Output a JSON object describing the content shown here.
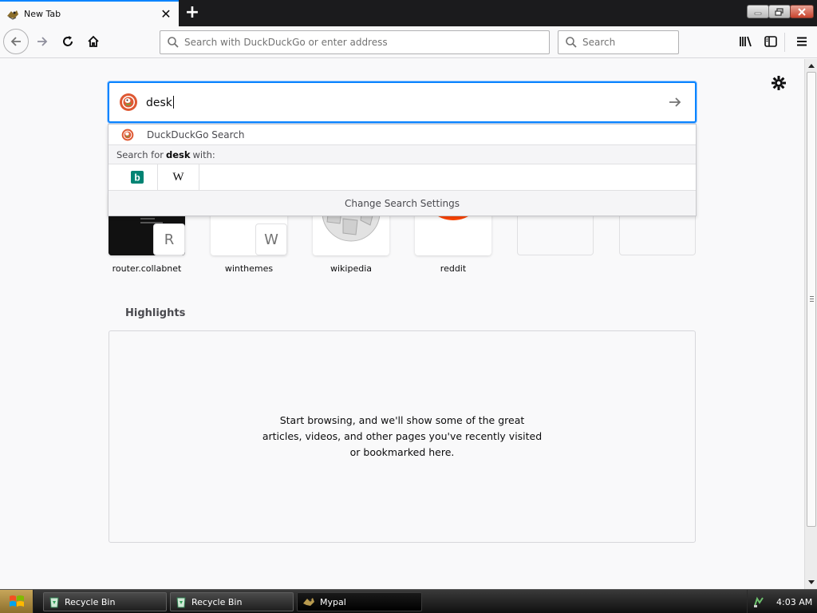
{
  "tab": {
    "title": "New Tab",
    "close_glyph": "✕",
    "new_tab_glyph": "+"
  },
  "toolbar": {
    "url_placeholder": "Search with DuckDuckGo or enter address",
    "search_placeholder": "Search"
  },
  "search": {
    "query": "desk",
    "suggestion_label": "DuckDuckGo Search",
    "search_for_prefix": "Search for",
    "search_for_term": "desk",
    "search_for_suffix": "with:",
    "engines": [
      "bing-icon",
      "wikipedia-icon"
    ],
    "wikipedia_letter": "W",
    "bing_letter": "b",
    "change_settings_label": "Change Search Settings"
  },
  "topsites": [
    {
      "label": "router.collabnet",
      "badge": "R",
      "icon": "terminal-screenshot"
    },
    {
      "label": "winthemes",
      "badge": "W",
      "icon": "blank-page"
    },
    {
      "label": "wikipedia",
      "badge": "",
      "icon": "wikipedia-globe-icon"
    },
    {
      "label": "reddit",
      "badge": "",
      "icon": "reddit-icon"
    },
    {
      "label": "",
      "badge": "",
      "icon": "empty"
    },
    {
      "label": "",
      "badge": "",
      "icon": "empty"
    }
  ],
  "highlights": {
    "title": "Highlights",
    "empty_text": "Start browsing, and we'll show some of the great articles, videos, and other pages you've recently visited or bookmarked here."
  },
  "taskbar": {
    "items": [
      {
        "label": "Recycle Bin",
        "icon": "recycle-bin-icon"
      },
      {
        "label": "Recycle Bin",
        "icon": "recycle-bin-icon"
      },
      {
        "label": "Mypal",
        "icon": "mypal-icon"
      }
    ],
    "clock": "4:03 AM"
  },
  "colors": {
    "accent": "#0a84ff",
    "reddit": "#ff4500",
    "ddg": "#de5833",
    "bing": "#008373"
  }
}
